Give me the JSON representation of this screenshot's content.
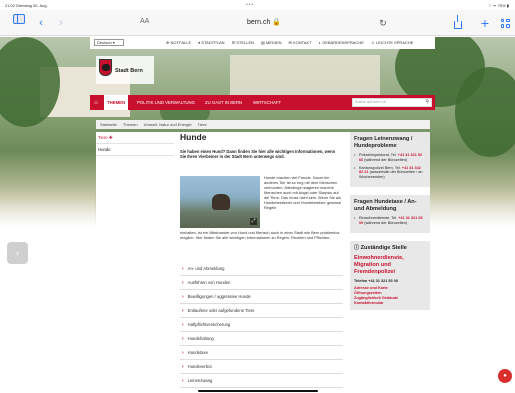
{
  "status_bar": {
    "time": "21:02 Dienstag 30. Aug.",
    "dots": "•••",
    "system": "⌔ ᯤ 75% ▮"
  },
  "browser": {
    "text_size": "AA",
    "url": "bern.ch 🔒",
    "reload": "↻",
    "back": "‹",
    "forward": "›",
    "plus": "+"
  },
  "meta": {
    "language": "Deutsch ▾",
    "links": [
      "⊕ NOTFÄLLE",
      "♦ STADTPLAN",
      "☰ STELLEN",
      "▤ MEDIEN",
      "✉ KONTAKT",
      "◗ GEBÄRDENSPRACHE",
      "☺ LEICHTE SPRACHE"
    ]
  },
  "logo": {
    "text": "Stadt Bern"
  },
  "nav": {
    "home": "⌂",
    "items": [
      "THEMEN",
      "POLITIK UND VERWALTUNG",
      "ZU GAST IN BERN",
      "WIRTSCHAFT"
    ],
    "search_placeholder": "Suche auf bern.ch",
    "search_icon": "⚲"
  },
  "breadcrumb": [
    "Startseite",
    "Themen",
    "Umwelt, Natur und Energie",
    "Tiere"
  ],
  "leftnav": {
    "back": "Tiere ✚",
    "current": "Hunde"
  },
  "main": {
    "title": "Hunde",
    "intro": "Sie haben einen Hund? Dann finden Sie hier alle wichtigen Informationen, wenn Sie Ihren Vierbeiner in der Stadt Bern unterwegs sind.",
    "body_right": "Hunde machen viel Freude. Kaum ein anderes Tier ist so eng mit dem Menschen verbunden. Allerdings reagieren manche Menschen auch mit Angst oder Skepsis auf die Tiere. Das muss nicht sein. Wenn Sie als Hundebesitzerin und Hundebesitzer gewisse Regeln",
    "body_full": "einhalten, ist ein Miteinander von Hund und Mensch auch in einer Stadt wie Bern problemlos möglich. Hier finden Sie alle wichtigen Informationen zu Regeln, Rechten und Pflichten.",
    "zoom": "⤢",
    "accordion": [
      "An- und Abmeldung",
      "Ausführen von Hunden",
      "Bewilligungen / aggressive Hunde",
      "Entlaufene oder aufgefundene Tiere",
      "Haftpflichtversicherung",
      "Hundehaltung",
      "Hundetaxe",
      "Hundeverbot",
      "Leinenzwang"
    ]
  },
  "aside": {
    "box1": {
      "title": "Fragen Leinenzwang / Hundeprobleme",
      "items": [
        {
          "pre": "Polizeiinspektorat, Tel. ",
          "tel": "+41 31 321 52 66",
          "post": " (während der Bürozeiten)"
        },
        {
          "pre": "Kantonspolizei Bern, Tel. ",
          "tel": "+41 31 342 82 21",
          "post": " (ausserhalb der Bürozeiten / an Wochenenden)"
        }
      ]
    },
    "box2": {
      "title": "Fragen Hundetaxe / An- und Abmeldung",
      "items": [
        {
          "pre": "Einwohnerdienste, Tel. ",
          "tel": "+41 31 321 53 00",
          "post": " (während der Bürozeiten)"
        }
      ]
    },
    "box3": {
      "title_icon": "ⓘ",
      "title": "Zuständige Stelle",
      "org": "Einwohnerdienste, Migration und Fremdenpolizei",
      "phone": "Telefon +41 31 321 53 00",
      "links": [
        "Adresse und Karte",
        "Öffnungszeiten",
        "Zugänglichkeit Gebäude",
        "Kontaktformular"
      ]
    }
  },
  "side_arrow": "›",
  "record": "●"
}
